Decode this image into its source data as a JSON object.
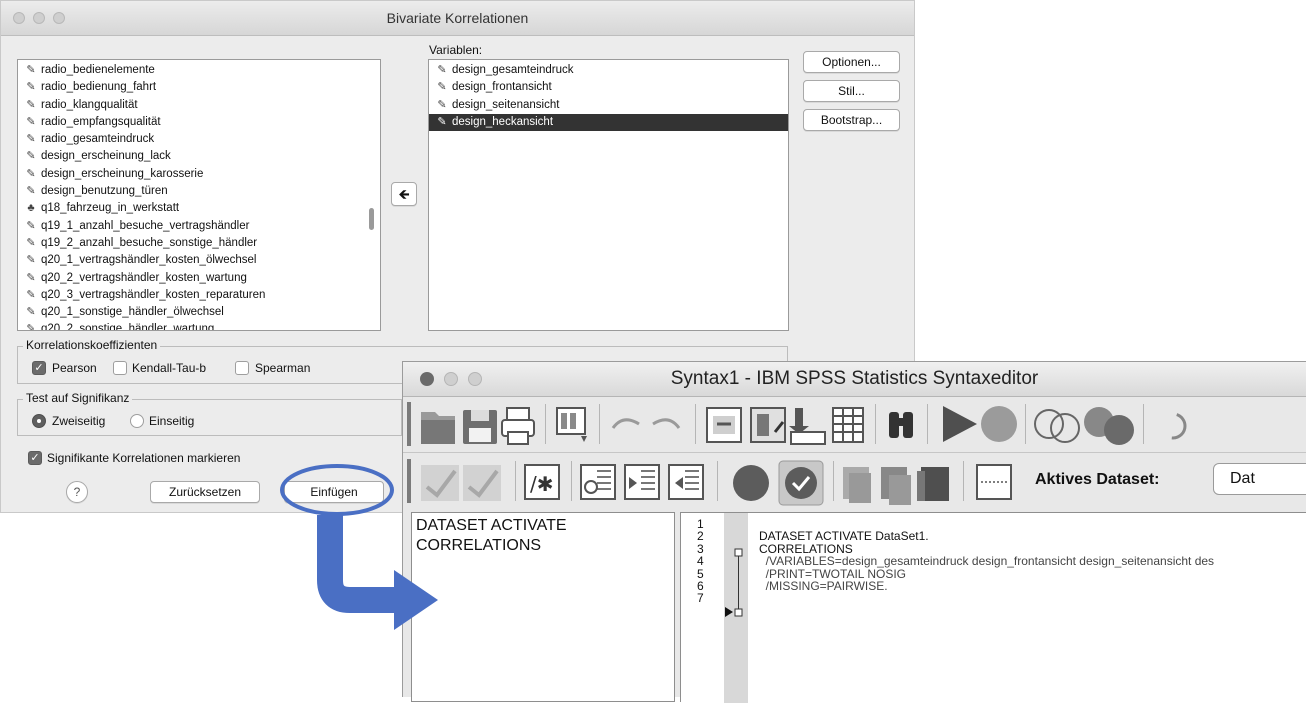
{
  "dialog": {
    "title": "Bivariate Korrelationen",
    "source_items": [
      {
        "icon": "scale-icon",
        "label": "radio_bedienelemente"
      },
      {
        "icon": "scale-icon",
        "label": "radio_bedienung_fahrt"
      },
      {
        "icon": "scale-icon",
        "label": "radio_klangqualität"
      },
      {
        "icon": "scale-icon",
        "label": "radio_empfangsqualität"
      },
      {
        "icon": "scale-icon",
        "label": "radio_gesamteindruck"
      },
      {
        "icon": "scale-icon",
        "label": "design_erscheinung_lack"
      },
      {
        "icon": "scale-icon",
        "label": "design_erscheinung_karosserie"
      },
      {
        "icon": "scale-icon",
        "label": "design_benutzung_türen"
      },
      {
        "icon": "nominal-icon",
        "label": "q18_fahrzeug_in_werkstatt"
      },
      {
        "icon": "scale-icon",
        "label": "q19_1_anzahl_besuche_vertragshändler"
      },
      {
        "icon": "scale-icon",
        "label": "q19_2_anzahl_besuche_sonstige_händler"
      },
      {
        "icon": "scale-icon",
        "label": "q20_1_vertragshändler_kosten_ölwechsel"
      },
      {
        "icon": "scale-icon",
        "label": "q20_2_vertragshändler_kosten_wartung"
      },
      {
        "icon": "scale-icon",
        "label": "q20_3_vertragshändler_kosten_reparaturen"
      },
      {
        "icon": "scale-icon",
        "label": "q20_1_sonstige_händler_ölwechsel"
      },
      {
        "icon": "scale-icon",
        "label": "q20_2_sonstige_händler_wartung"
      }
    ],
    "variables_label": "Variablen:",
    "variables": [
      {
        "icon": "scale-icon",
        "label": "design_gesamteindruck",
        "selected": false
      },
      {
        "icon": "scale-icon",
        "label": "design_frontansicht",
        "selected": false
      },
      {
        "icon": "scale-icon",
        "label": "design_seitenansicht",
        "selected": false
      },
      {
        "icon": "scale-icon",
        "label": "design_heckansicht",
        "selected": true
      }
    ],
    "move_arrow": "🡸",
    "buttons": {
      "options": "Optionen...",
      "style": "Stil...",
      "bootstrap": "Bootstrap..."
    },
    "coefficients": {
      "legend": "Korrelationskoeffizienten",
      "pearson": {
        "label": "Pearson",
        "checked": true
      },
      "kendall": {
        "label": "Kendall-Tau-b",
        "checked": false
      },
      "spearman": {
        "label": "Spearman",
        "checked": false
      }
    },
    "significance": {
      "legend": "Test auf Signifikanz",
      "two_tailed": {
        "label": "Zweiseitig",
        "selected": true
      },
      "one_tailed": {
        "label": "Einseitig",
        "selected": false
      }
    },
    "flag_significant": {
      "label": "Signifikante Korrelationen markieren",
      "checked": true
    },
    "footer": {
      "help": "?",
      "reset": "Zurücksetzen",
      "paste": "Einfügen"
    }
  },
  "annotation": {
    "highlight_color": "#4a6fc4"
  },
  "syntax_editor": {
    "title": "Syntax1 - IBM SPSS Statistics Syntaxeditor",
    "active_dataset_label": "Aktives Dataset:",
    "active_dataset_value": "Dat",
    "nav_items": [
      "DATASET ACTIVATE",
      "CORRELATIONS"
    ],
    "line_numbers": [
      "1",
      "2",
      "3",
      "4",
      "5",
      "6",
      "7"
    ],
    "code": [
      "",
      "DATASET ACTIVATE DataSet1.",
      "CORRELATIONS",
      "  /VARIABLES=design_gesamteindruck design_frontansicht design_seitenansicht des",
      "  /PRINT=TWOTAIL NOSIG",
      "  /MISSING=PAIRWISE.",
      ""
    ],
    "toolbar_row1": [
      "open-file-icon",
      "save-icon",
      "print-icon",
      "dialog-recall-icon",
      "undo-icon",
      "redo-icon",
      "goto-case-icon",
      "goto-variable-icon",
      "variables-icon",
      "value-labels-icon",
      "find-icon",
      "run-selection-icon",
      "stop-icon",
      "split-file-icon",
      "weight-cases-icon"
    ],
    "toolbar_row2": [
      "validate-icon",
      "validate-all-icon",
      "comment-icon",
      "outdent-icon",
      "indent-icon",
      "auto-indent-icon",
      "breakpoint-icon",
      "bookmark-check-icon",
      "next-bookmark-icon",
      "prev-bookmark-icon",
      "clear-bookmarks-icon",
      "show-line-numbers-icon"
    ]
  }
}
